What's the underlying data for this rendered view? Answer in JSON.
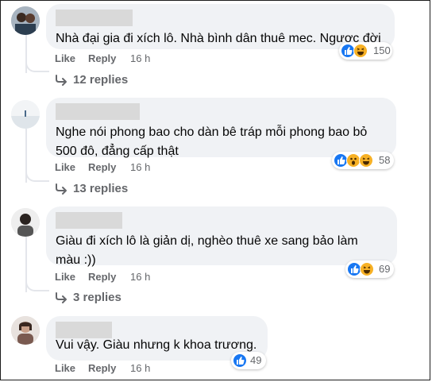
{
  "actions": {
    "like": "Like",
    "reply": "Reply"
  },
  "comments": [
    {
      "text": "Nhà đại gia đi xích lô. Nhà bình dân thuê mec. Ngược đời",
      "time": "16 h",
      "reaction_count": "150",
      "reactions": [
        "like-icon",
        "haha-icon"
      ],
      "replies": "12 replies"
    },
    {
      "text_lines": [
        "Nghe nói phong bao cho dàn bê tráp mỗi phong bao bỏ",
        "500 đô, đẳng cấp thật"
      ],
      "time": "16 h",
      "reaction_count": "58",
      "reactions": [
        "like-icon",
        "wow-icon",
        "haha-icon"
      ],
      "replies": "13 replies"
    },
    {
      "text_lines": [
        "Giàu đi xích lô là giản dị, nghèo thuê xe sang bảo làm",
        "màu :))"
      ],
      "time": "16 h",
      "reaction_count": "69",
      "reactions": [
        "like-icon",
        "haha-icon"
      ],
      "replies": "3 replies"
    },
    {
      "text": "Vui vậy. Giàu nhưng k khoa trương.",
      "time": "16 h",
      "reaction_count": "49",
      "reactions": [
        "like-icon"
      ]
    }
  ],
  "colors": {
    "like": "#1877f2",
    "haha": "#f7b125",
    "bubble": "#f0f2f5",
    "muted": "#65676b"
  }
}
